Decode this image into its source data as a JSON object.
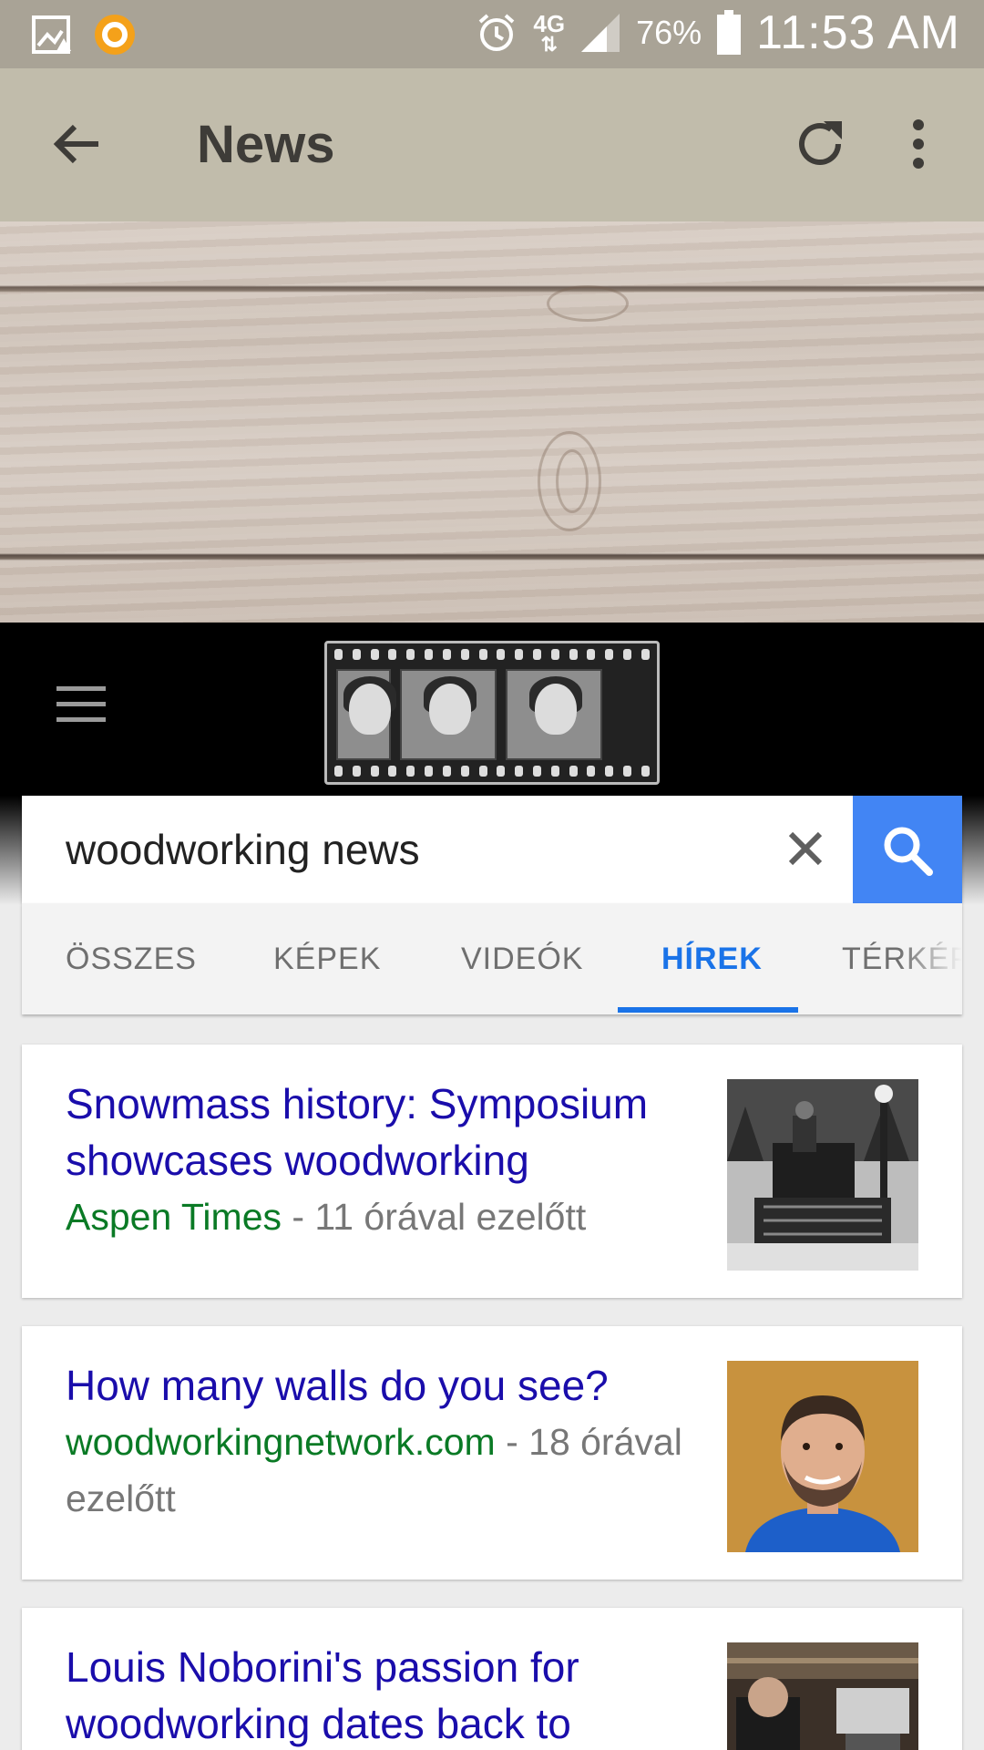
{
  "status_bar": {
    "network": "4G",
    "battery": "76%",
    "time": "11:53 AM"
  },
  "app_bar": {
    "title": "News"
  },
  "search": {
    "query": "woodworking news"
  },
  "tabs": [
    {
      "label": "ÖSSZES",
      "active": false
    },
    {
      "label": "KÉPEK",
      "active": false
    },
    {
      "label": "VIDEÓK",
      "active": false
    },
    {
      "label": "HÍREK",
      "active": true
    },
    {
      "label": "TÉRKÉP",
      "active": false
    }
  ],
  "results": [
    {
      "headline": "Snowmass history: Symposium showcases woodworking",
      "source": "Aspen Times",
      "age": " - 11 órával ezelőtt",
      "thumb_icon": "photo-black-white-truck"
    },
    {
      "headline": "How many walls do you see?",
      "source": "woodworkingnetwork.com",
      "age": " - 18 órával ezelőtt",
      "thumb_icon": "photo-portrait-man"
    },
    {
      "headline": "Louis Noborini's passion for woodworking dates back to",
      "source": "",
      "age": "",
      "thumb_icon": "photo-workshop"
    }
  ],
  "colors": {
    "status_bar": "#a9a396",
    "app_bar": "#c1bcab",
    "accent_blue": "#4285f4",
    "headline_link": "#1a0dab",
    "source_green": "#0a7a25"
  }
}
